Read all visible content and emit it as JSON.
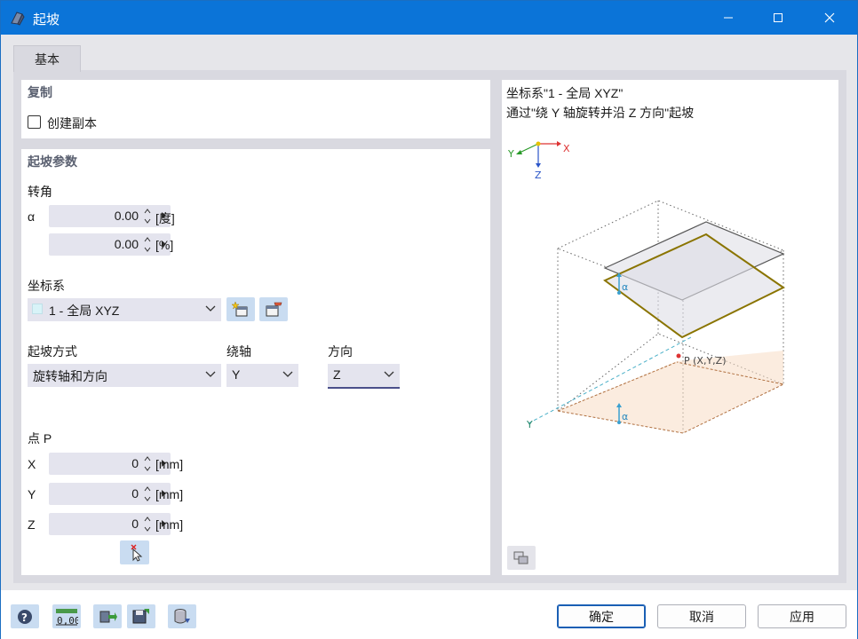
{
  "window": {
    "title": "起坡"
  },
  "tabs": [
    {
      "label": "基本"
    }
  ],
  "copy_section": {
    "title": "复制",
    "create_copy_label": "创建副本",
    "create_copy_checked": false
  },
  "params_section": {
    "title": "起坡参数",
    "rotation_label": "转角",
    "alpha_symbol": "α",
    "alpha_deg": "0.00",
    "alpha_deg_unit": "[度]",
    "alpha_pct": "0.00",
    "alpha_pct_unit": "[%]",
    "coord_label": "坐标系",
    "coord_value": "1 - 全局 XYZ",
    "method_label": "起坡方式",
    "method_value": "旋转轴和方向",
    "axis_label": "绕轴",
    "axis_value": "Y",
    "direction_label": "方向",
    "direction_value": "Z",
    "point_label": "点 P",
    "x_label": "X",
    "x_value": "0",
    "x_unit": "[mm]",
    "y_label": "Y",
    "y_value": "0",
    "y_unit": "[mm]",
    "z_label": "Z",
    "z_value": "0",
    "z_unit": "[mm]"
  },
  "preview": {
    "line1": "坐标系\"1 - 全局 XYZ\"",
    "line2": "通过\"绕 Y 轴旋转并沿 Z 方向\"起坡",
    "axis_x": "X",
    "axis_y": "Y",
    "axis_z": "Z",
    "alpha_upper": "α",
    "alpha_lower": "α",
    "point_label": "P (X,Y,Z)",
    "y_axis_label": "Y"
  },
  "footer": {
    "ok": "确定",
    "cancel": "取消",
    "apply": "应用"
  },
  "colors": {
    "titlebar": "#0b74d8",
    "accent": "#4a4f8a",
    "button_fill": "#c9dcf1",
    "input_fill": "#e4e4ee"
  }
}
